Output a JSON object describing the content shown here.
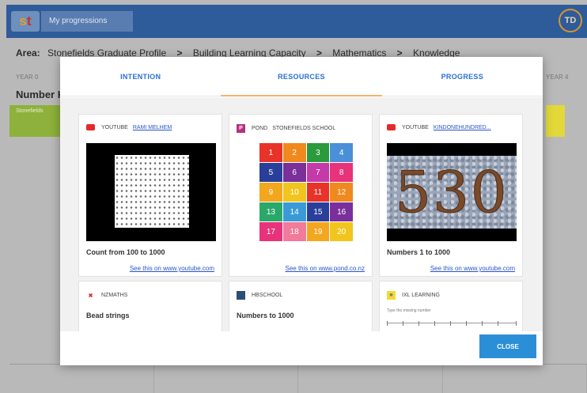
{
  "app": {
    "nav_item": "My progressions",
    "avatar_initials": "TD"
  },
  "breadcrumb": {
    "area_label": "Area:",
    "items": [
      "Stonefields Graduate Profile",
      "Building Learning Capacity",
      "Mathematics",
      "Knowledge"
    ],
    "separator": ">"
  },
  "background": {
    "year_left": "YEAR 0",
    "year_right": "YEAR 4",
    "subject": "Number K",
    "strip_text": "Stonefields"
  },
  "modal": {
    "tabs": [
      {
        "label": "INTENTION",
        "active": false
      },
      {
        "label": "RESOURCES",
        "active": true
      },
      {
        "label": "PROGRESS",
        "active": false
      }
    ],
    "cards": [
      {
        "source": "YOUTUBE",
        "author": "RAMI MELHEM",
        "title": "Count from 100 to 1000",
        "link": "See this on www.youtube.com",
        "icon": "youtube-icon"
      },
      {
        "source": "POND",
        "author": "STONEFIELDS SCHOOL",
        "title": "",
        "link": "See this on www.pond.co.nz",
        "icon": "pond-icon"
      },
      {
        "source": "YOUTUBE",
        "author": "KINDONEHUNDRED...",
        "title": "Numbers 1 to 1000",
        "link": "See this on www.youtube.com",
        "icon": "youtube-icon"
      },
      {
        "source": "NZMATHS",
        "author": "",
        "title": "Bead strings",
        "link": "",
        "icon": "nzmaths-icon"
      },
      {
        "source": "HBSCHOOL",
        "author": "",
        "title": "Numbers to 1000",
        "link": "",
        "icon": "hbschool-icon"
      },
      {
        "source": "IXL LEARNING",
        "author": "",
        "title": "",
        "link": "",
        "icon": "ixl-icon",
        "subtitle": "Type the missing number"
      }
    ],
    "pond_tiles": [
      "1",
      "2",
      "3",
      "4",
      "5",
      "6",
      "7",
      "8",
      "9",
      "10",
      "11",
      "12",
      "13",
      "14",
      "15",
      "16",
      "17",
      "18",
      "19",
      "20"
    ],
    "pond_colors": [
      "#e8332a",
      "#f08a1e",
      "#2a9a3c",
      "#4a8fd8",
      "#2a3f9a",
      "#7a2f9a",
      "#c43aa8",
      "#e8337a",
      "#f2a71e",
      "#f2c51e",
      "#e8332a",
      "#f08a1e",
      "#2aa86a",
      "#3a9ad8",
      "#2a3f9a",
      "#7a2f9a",
      "#e8337a",
      "#f27a9a",
      "#f2a71e",
      "#f2c51e"
    ],
    "video3_number": "530",
    "close_label": "CLOSE"
  }
}
